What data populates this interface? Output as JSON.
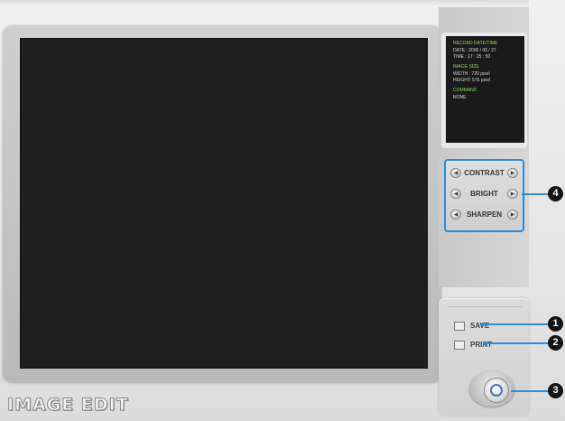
{
  "app": {
    "title": "IMAGE EDIT"
  },
  "info": {
    "record_heading": "RECORD DATE/TIME",
    "date_line": "DATE : 2006 / 06 / 27",
    "time_line": "TIME : 17 : 25 : 50",
    "size_heading": "IMAGE SIZE",
    "width_line": "WIDTH : 720 pixel",
    "height_line": "HEIGHT: 576 pixel",
    "command_heading": "COMMAND",
    "command_value": "NONE"
  },
  "adjust": {
    "contrast_label": "CONTRAST",
    "bright_label": "BRIGHT",
    "sharpen_label": "SHARPEN"
  },
  "actions": {
    "save_label": "SAVE",
    "print_label": "PRINT"
  },
  "callouts": {
    "one": "1",
    "two": "2",
    "three": "3",
    "four": "4"
  },
  "icons": {
    "arrow_left": "left-arrow-icon",
    "arrow_right": "right-arrow-icon",
    "power": "power-icon"
  },
  "colors": {
    "viewer_bg": "#1e1e1e",
    "info_heading": "#8fd36a",
    "callout_accent": "#2f8dd8"
  }
}
